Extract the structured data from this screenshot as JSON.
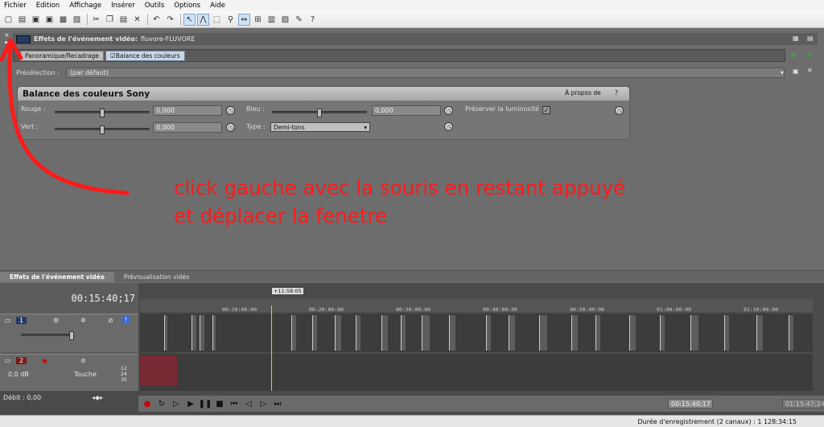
{
  "menu": [
    "Fichier",
    "Edition",
    "Affichage",
    "Insérer",
    "Outils",
    "Options",
    "Aide"
  ],
  "toolbar_icons": [
    "new-icon",
    "open-icon",
    "save-icon",
    "save-as-icon",
    "render-icon",
    "properties-icon",
    "cut-icon",
    "copy-icon",
    "paste-icon",
    "delete-icon",
    "undo-icon",
    "redo-icon",
    "normal-edit-tool-icon",
    "envelope-tool-icon",
    "selection-tool-icon",
    "zoom-tool-icon",
    "auto-ripple-icon",
    "snap-icon",
    "lock-envelopes-icon",
    "ignore-grouping-icon",
    "auto-crossfade-icon",
    "marker-icon",
    "help-icon"
  ],
  "fx": {
    "title": "Effets de l'événement vidéo:",
    "event": "fluvore-FLUVORE",
    "chain": [
      "Panoramique/Recadrage",
      "Balance des couleurs"
    ],
    "preset_label": "Présélection :",
    "preset_value": "(par défaut)",
    "plugin_name": "Balance des couleurs Sony",
    "about": "À propos de",
    "help": "?",
    "params": {
      "rouge_label": "Rouge :",
      "rouge_value": "0,000",
      "vert_label": "Vert :",
      "vert_value": "0,000",
      "bleu_label": "Bleu :",
      "bleu_value": "0,000",
      "type_label": "Type :",
      "type_value": "Demi-tons",
      "preserve_label": "Préserver la luminosité :"
    }
  },
  "annotation": {
    "line1": "click gauche avec la souris en restant appuyé",
    "line2": "et déplacer la fenetre"
  },
  "tabs": [
    "Effets de l'événement vidéo",
    "Prévisualisation vidéo"
  ],
  "timeline": {
    "timecode": "00:15:40;17",
    "loop_marker": "+11:58:05",
    "ruler_ticks": [
      "00:10:00:00",
      "00:20:00:00",
      "00:30:00:00",
      "00:40:00:00",
      "00:50:00:00",
      "01:00:00:00",
      "01:10:00:00"
    ],
    "track1_number": "1",
    "track2_number": "2",
    "track2_volume": "0,0 dB",
    "track2_mode": "Touche",
    "debit": "Débit : 0,00",
    "transport_time": "00:15:40;17",
    "end_time": "01:15:47;24",
    "audio_levels": [
      "12",
      "24",
      "36"
    ]
  },
  "status": "Durée d'enregistrement (2 canaux) : 1 128:34:15"
}
